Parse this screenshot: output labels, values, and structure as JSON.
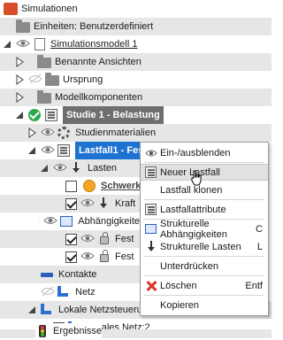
{
  "tree": {
    "root_label": "Simulationen",
    "units_label": "Einheiten: Benutzerdefiniert",
    "model_label": "Simulationsmodell 1",
    "named_views_label": "Benannte Ansichten",
    "origin_label": "Ursprung",
    "model_components_label": "Modellkomponenten",
    "study_label": "Studie 1 - Belastung",
    "study_materials_label": "Studienmaterialien",
    "loadcase_label": "Lastfall1 - Fest",
    "loads_label": "Lasten",
    "gravity_label": "Schwerkr",
    "force_label": "Kraft",
    "dependencies_label": "Abhängigkeite",
    "fixed1_label": "Fest",
    "fixed2_label": "Fest",
    "contacts_label": "Kontakte",
    "mesh_label": "Netz",
    "local_mesh_controls_label": "Lokale Netzsteuerungen",
    "local_mesh_label": "Lokales Netz:2",
    "results_label": "Ergebnisse"
  },
  "context_menu": {
    "items": [
      {
        "label": "Ein-/ausblenden",
        "shortcut": ""
      },
      {
        "label": "Neuer Lastfall",
        "shortcut": ""
      },
      {
        "label": "Lastfall klonen",
        "shortcut": ""
      },
      {
        "label": "Lastfallattribute",
        "shortcut": ""
      },
      {
        "label": "Strukturelle Abhängigkeiten",
        "shortcut": "C"
      },
      {
        "label": "Strukturelle Lasten",
        "shortcut": "L"
      },
      {
        "label": "Unterdrücken",
        "shortcut": ""
      },
      {
        "label": "Löschen",
        "shortcut": "Entf"
      },
      {
        "label": "Kopieren",
        "shortcut": ""
      }
    ]
  },
  "colors": {
    "study_highlight": "#6e6e6e",
    "selection_highlight": "#1e73d2",
    "band": "#e6e6e6",
    "delete_icon": "#d9342b"
  }
}
